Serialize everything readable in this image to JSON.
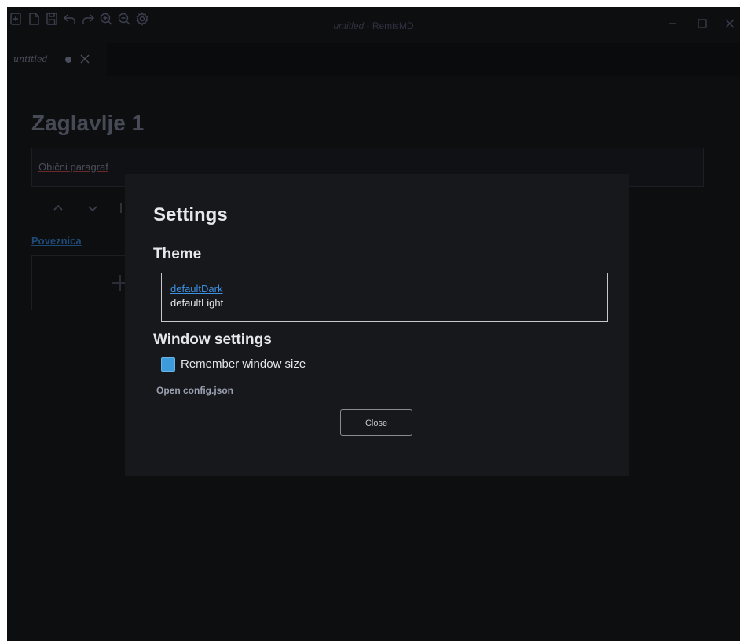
{
  "window": {
    "title_file": "untitled",
    "title_sep": " - ",
    "title_app": "RemisMD"
  },
  "toolbar": {
    "icons": [
      "new-file-icon",
      "open-file-icon",
      "save-icon",
      "undo-icon",
      "redo-icon",
      "zoom-in-icon",
      "zoom-out-icon",
      "gear-icon"
    ]
  },
  "tab": {
    "label": "untitled"
  },
  "editor": {
    "heading": "Zaglavlje 1",
    "paragraph": "Obični paragraf",
    "link": "Poveznica"
  },
  "settings": {
    "title": "Settings",
    "theme_heading": "Theme",
    "themes": [
      "defaultDark",
      "defaultLight"
    ],
    "selected_theme": "defaultDark",
    "window_heading": "Window settings",
    "remember_label": "Remember window size",
    "remember_checked": true,
    "open_config": "Open config.json",
    "close_label": "Close"
  },
  "colors": {
    "accent": "#3d9bdc",
    "dialog_bg": "#17181c",
    "app_bg": "#0d0e10"
  }
}
